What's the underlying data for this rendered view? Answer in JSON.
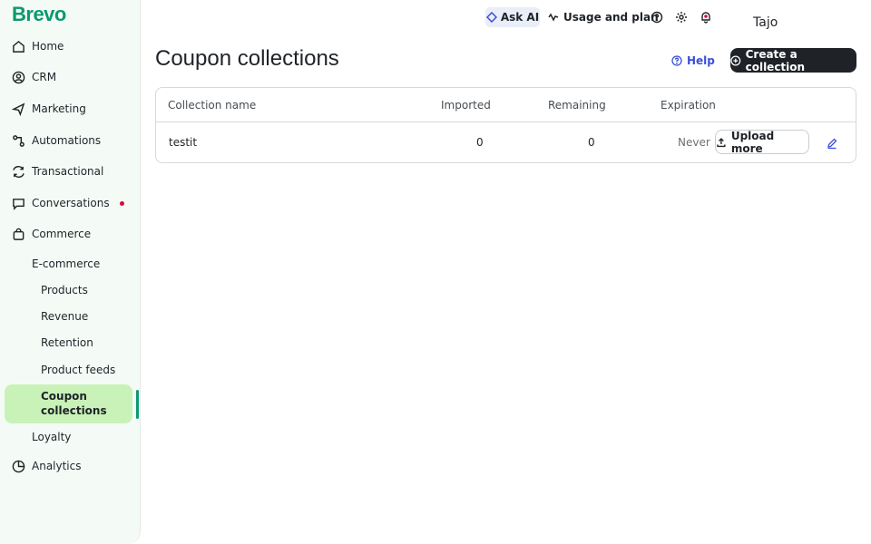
{
  "brand": {
    "logo_text": "Brevo",
    "color": "#0b996e"
  },
  "sidebar": {
    "items": [
      {
        "label": "Home",
        "icon": "home-icon"
      },
      {
        "label": "CRM",
        "icon": "contacts-icon"
      },
      {
        "label": "Marketing",
        "icon": "send-icon"
      },
      {
        "label": "Automations",
        "icon": "automation-icon"
      },
      {
        "label": "Transactional",
        "icon": "transactional-icon"
      },
      {
        "label": "Conversations",
        "icon": "chat-icon"
      },
      {
        "label": "Commerce",
        "icon": "bag-icon"
      },
      {
        "label": "Analytics",
        "icon": "pie-chart-icon"
      }
    ],
    "commerce_sub": {
      "ecommerce": "E-commerce",
      "items": [
        "Products",
        "Revenue",
        "Retention",
        "Product feeds"
      ],
      "active": "Coupon collections",
      "loyalty": "Loyalty"
    }
  },
  "topbar": {
    "ask_ai": "Ask AI",
    "usage": "Usage and plan",
    "user": "Tajo"
  },
  "header": {
    "title": "Coupon collections",
    "help": "Help",
    "create": "Create a collection"
  },
  "table": {
    "columns": [
      "Collection name",
      "Imported",
      "Remaining",
      "Expiration"
    ],
    "rows": [
      {
        "name": "testit",
        "imported": "0",
        "remaining": "0",
        "expiration": "Never",
        "action": "Upload more"
      }
    ]
  },
  "colors": {
    "accent": "#0b996e",
    "active_bg": "#c9f2b8",
    "link": "#3b4fd8",
    "notification": "#d9083a"
  }
}
